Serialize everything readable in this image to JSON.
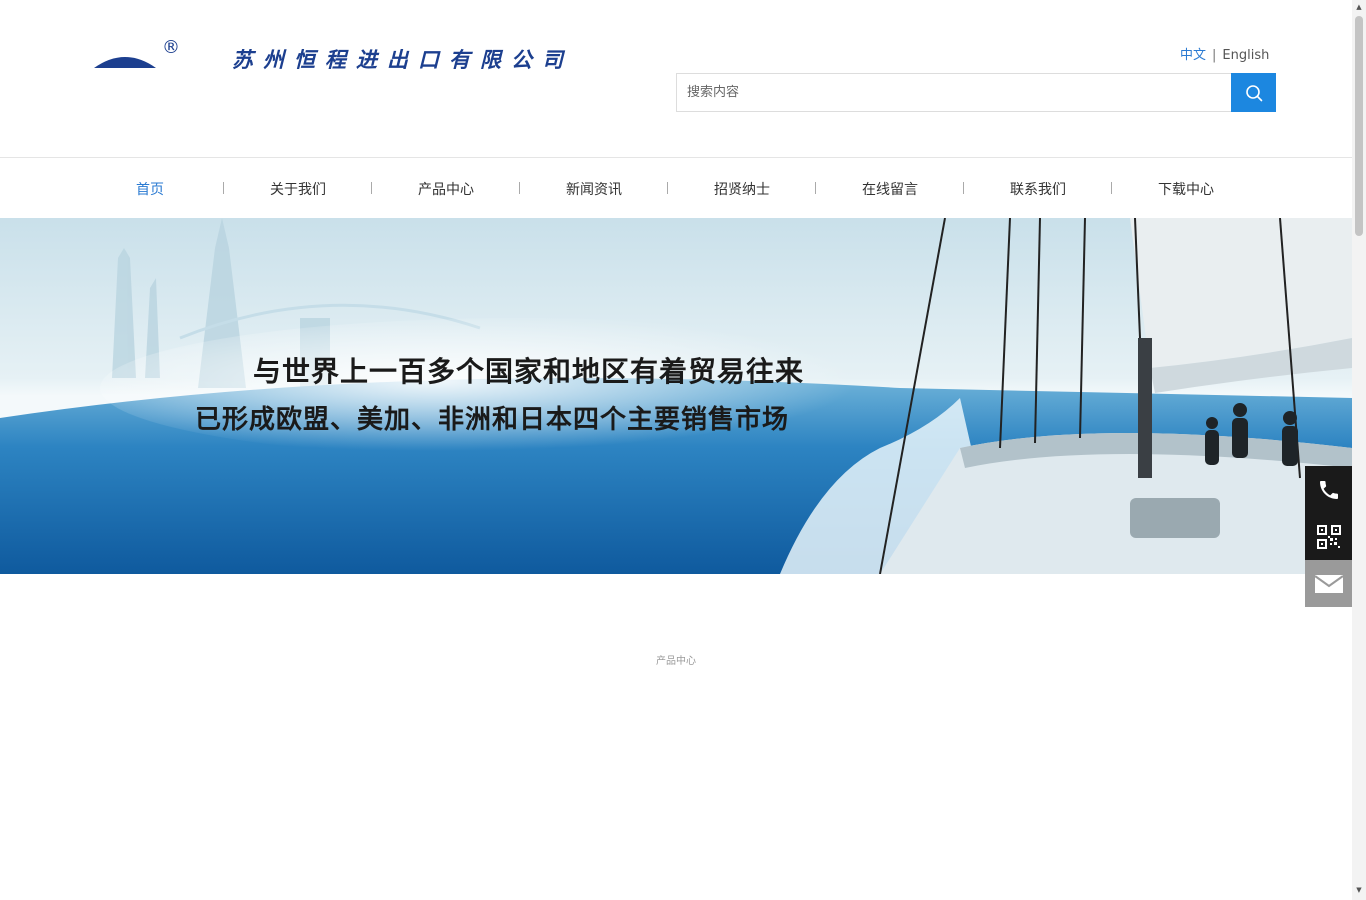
{
  "header": {
    "logo_reg_mark": "®",
    "company_name": "苏州恒程进出口有限公司",
    "lang": {
      "active": "中文",
      "separator": "|",
      "other": "English"
    },
    "search": {
      "placeholder": "搜索内容",
      "value": ""
    }
  },
  "nav": {
    "items": [
      {
        "label": "首页"
      },
      {
        "label": "关于我们"
      },
      {
        "label": "产品中心"
      },
      {
        "label": "新闻资讯"
      },
      {
        "label": "招贤纳士"
      },
      {
        "label": "在线留言"
      },
      {
        "label": "联系我们"
      },
      {
        "label": "下载中心"
      }
    ],
    "active_index": 0
  },
  "banner": {
    "line1": "与世界上一百多个国家和地区有着贸易往来",
    "line2": "已形成欧盟、美加、非洲和日本四个主要销售市场",
    "slides": 2,
    "current_slide": 1
  },
  "section": {
    "title": "产品中心",
    "subtitle": ""
  },
  "side_float": [
    "phone-icon",
    "qr-code-icon",
    "mail-icon"
  ],
  "colors": {
    "accent": "#2a7ad2",
    "search_button": "#1c87e0",
    "logo_blue": "#1c3f8f",
    "side_dark": "#1a1a1a"
  }
}
